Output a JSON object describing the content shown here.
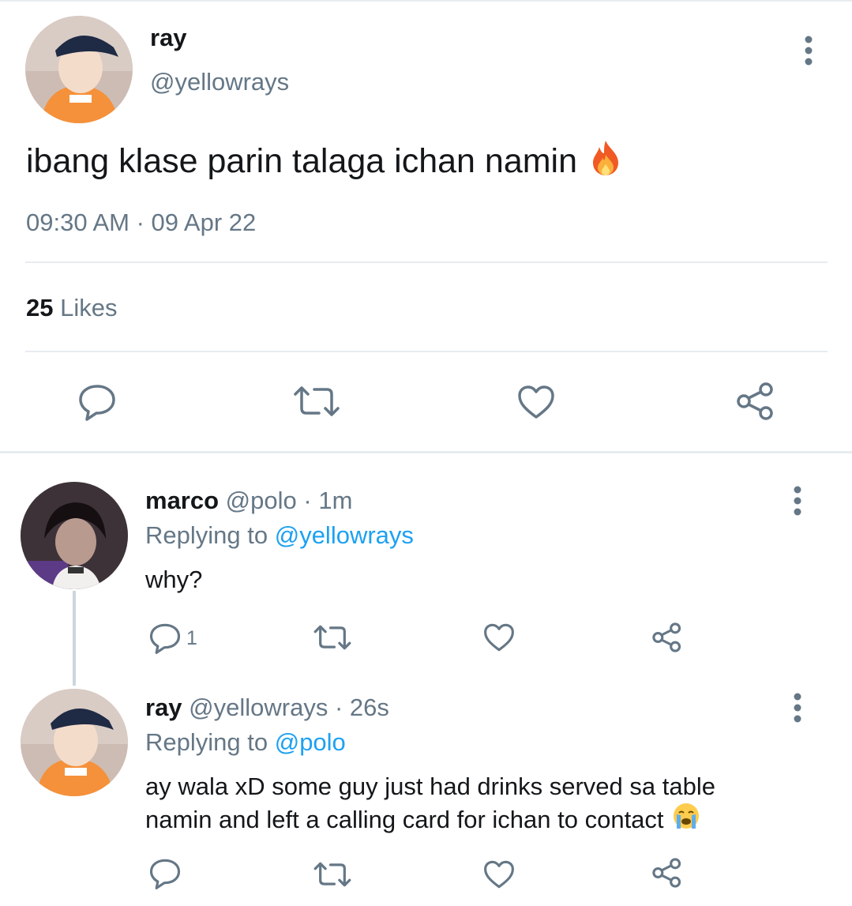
{
  "main_tweet": {
    "display_name": "ray",
    "handle": "@yellowrays",
    "text": "ibang klase parin talaga ichan namin",
    "emoji": "fire-emoji",
    "timestamp": "09:30 AM · 09 Apr 22",
    "likes_count": "25",
    "likes_label": "Likes"
  },
  "replies": [
    {
      "display_name": "marco",
      "handle": "@polo",
      "time": "· 1m",
      "replying_prefix": "Replying to",
      "replying_to": "@yellowrays",
      "text": "why?",
      "reply_count": "1"
    },
    {
      "display_name": "ray",
      "handle": "@yellowrays",
      "time": "· 26s",
      "replying_prefix": "Replying to",
      "replying_to": "@polo",
      "text_line1": "ay wala xD some guy just had drinks served sa table",
      "text_line2": "namin and left a calling card for ichan to contact",
      "emoji": "crying-emoji"
    }
  ],
  "colors": {
    "text": "#14171a",
    "secondary": "#657786",
    "accent": "#1da1f2",
    "divider": "#e6ecf0",
    "icon": "#657786"
  }
}
